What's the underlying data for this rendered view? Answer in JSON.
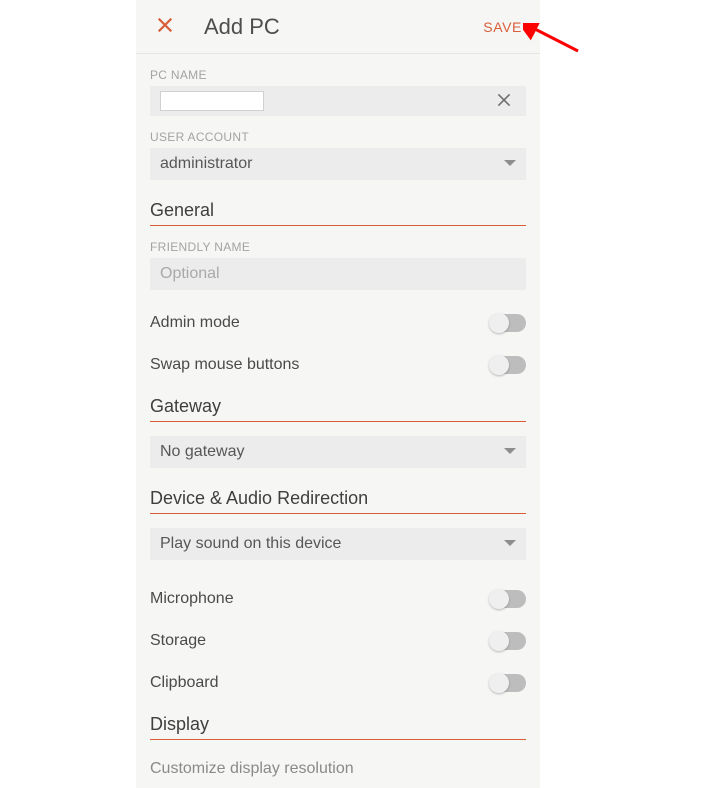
{
  "header": {
    "title": "Add PC",
    "save_label": "SAVE"
  },
  "pcname": {
    "label": "PC NAME",
    "value": ""
  },
  "user_account": {
    "label": "USER ACCOUNT",
    "selected": "administrator"
  },
  "sections": {
    "general": {
      "title": "General",
      "friendly_name_label": "FRIENDLY NAME",
      "friendly_name_value": "",
      "friendly_name_placeholder": "Optional",
      "admin_mode_label": "Admin mode",
      "swap_mouse_label": "Swap mouse buttons"
    },
    "gateway": {
      "title": "Gateway",
      "selected": "No gateway"
    },
    "device_audio": {
      "title": "Device & Audio Redirection",
      "sound_selected": "Play sound on this device",
      "microphone_label": "Microphone",
      "storage_label": "Storage",
      "clipboard_label": "Clipboard"
    },
    "display": {
      "title": "Display",
      "customize_label": "Customize display resolution"
    }
  }
}
